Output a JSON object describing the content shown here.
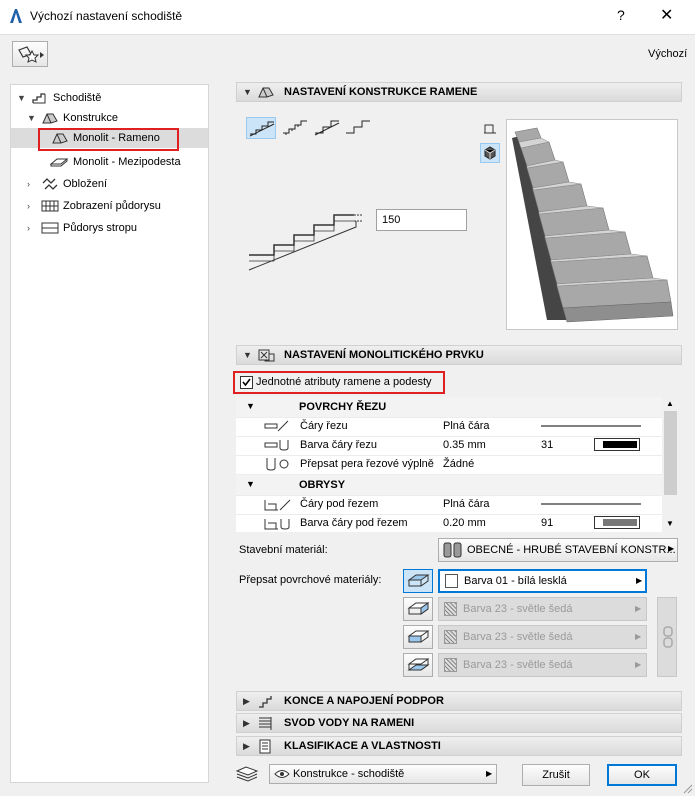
{
  "window": {
    "title": "Výchozí nastavení schodiště",
    "help": "?",
    "close": "✕"
  },
  "toolbar": {
    "default_label": "Výchozí"
  },
  "tree": {
    "items": [
      {
        "label": "Schodiště"
      },
      {
        "label": "Konstrukce"
      },
      {
        "label": "Monolit - Rameno"
      },
      {
        "label": "Monolit - Mezipodesta"
      },
      {
        "label": "Obložení"
      },
      {
        "label": "Zobrazení půdorysu"
      },
      {
        "label": "Půdorys stropu"
      }
    ]
  },
  "sections": {
    "s1": "NASTAVENÍ KONSTRUKCE RAMENE",
    "s2": "NASTAVENÍ MONOLITICKÉHO PRVKU",
    "s3": "KONCE A NAPOJENÍ PODPOR",
    "s4": "SVOD VODY NA RAMENI",
    "s5": "KLASIFIKACE A VLASTNOSTI"
  },
  "structure": {
    "thickness_value": "150"
  },
  "monolith": {
    "unified_label": "Jednotné atributy ramene a podesty",
    "unified_checked": true,
    "groups": [
      {
        "header": "POVRCHY ŘEZU",
        "rows": [
          {
            "name": "Čáry řezu",
            "value": "Plná čára",
            "num": ""
          },
          {
            "name": "Barva čáry řezu",
            "value": "0.35 mm",
            "num": "31"
          },
          {
            "name": "Přepsat pera řezové výplně",
            "value": "Žádné",
            "num": ""
          }
        ]
      },
      {
        "header": "OBRYSY",
        "rows": [
          {
            "name": "Čáry pod řezem",
            "value": "Plná čára",
            "num": ""
          },
          {
            "name": "Barva čáry pod řezem",
            "value": "0.20 mm",
            "num": "91"
          }
        ]
      }
    ],
    "building_material_label": "Stavební materiál:",
    "building_material_value": "OBECNÉ - HRUBÉ STAVEBNÍ KONSTR...",
    "override_label": "Přepsat povrchové materiály:",
    "surfaces": [
      "Barva 01 - bílá lesklá",
      "Barva 23 - světle šedá",
      "Barva 23 - světle šedá",
      "Barva 23 - světle šedá"
    ]
  },
  "footer": {
    "view_value": "Konstrukce - schodiště",
    "cancel": "Zrušit",
    "ok": "OK"
  },
  "colors": {
    "accent": "#0078d7",
    "highlight": "#e02020"
  }
}
